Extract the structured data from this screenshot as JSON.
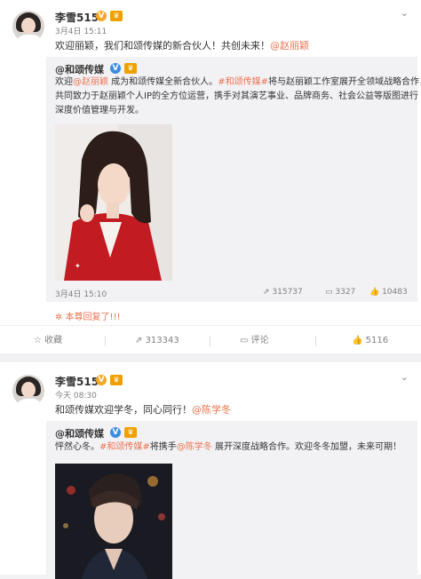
{
  "post1": {
    "user": {
      "name": "李雪515",
      "v_badge": "V"
    },
    "time": "3月4日 15:11",
    "text_before": "欢迎丽颖，我们和颂传媒的新合伙人！共创未来！",
    "text_mention": "@赵丽颖",
    "repost": {
      "author": "@和颂传媒",
      "v_badge": "V",
      "line1_a": "欢迎",
      "line1_mention": "@赵丽颖",
      "line1_b": " 成为和颂传媒全新合伙人。",
      "line1_topic": "#和颂传媒#",
      "line1_c": "将与赵丽颖工作室展开全领域战略合作，",
      "line2": "共同致力于赵丽颖个人IP的全方位运营，携手对其演艺事业、品牌商务、社会公益等版图进行",
      "line3": "深度价值管理与开发。",
      "time": "3月4日 15:10",
      "share_count": "315737",
      "comment_count": "3327",
      "like_count": "10483"
    },
    "reply_note": "本尊回复了!!!",
    "actions": {
      "fav": "收藏",
      "share": "313343",
      "comment": "评论",
      "like": "5116"
    }
  },
  "post2": {
    "user": {
      "name": "李雪515",
      "v_badge": "V"
    },
    "time": "今天 08:30",
    "text_before": "和颂传媒欢迎学冬，同心同行！",
    "text_mention": "@陈学冬",
    "repost": {
      "author": "@和颂传媒",
      "v_badge": "V",
      "line1_a": "怦然心冬。",
      "line1_topic": "#和颂传媒#",
      "line1_b": "将携手",
      "line1_mention": "@陈学冬",
      "line1_c": " 展开深度战略合作。欢迎冬冬加盟，未来可期！"
    }
  },
  "icons": {
    "chevron": "chevron-down-icon",
    "crown": "crown-icon"
  }
}
